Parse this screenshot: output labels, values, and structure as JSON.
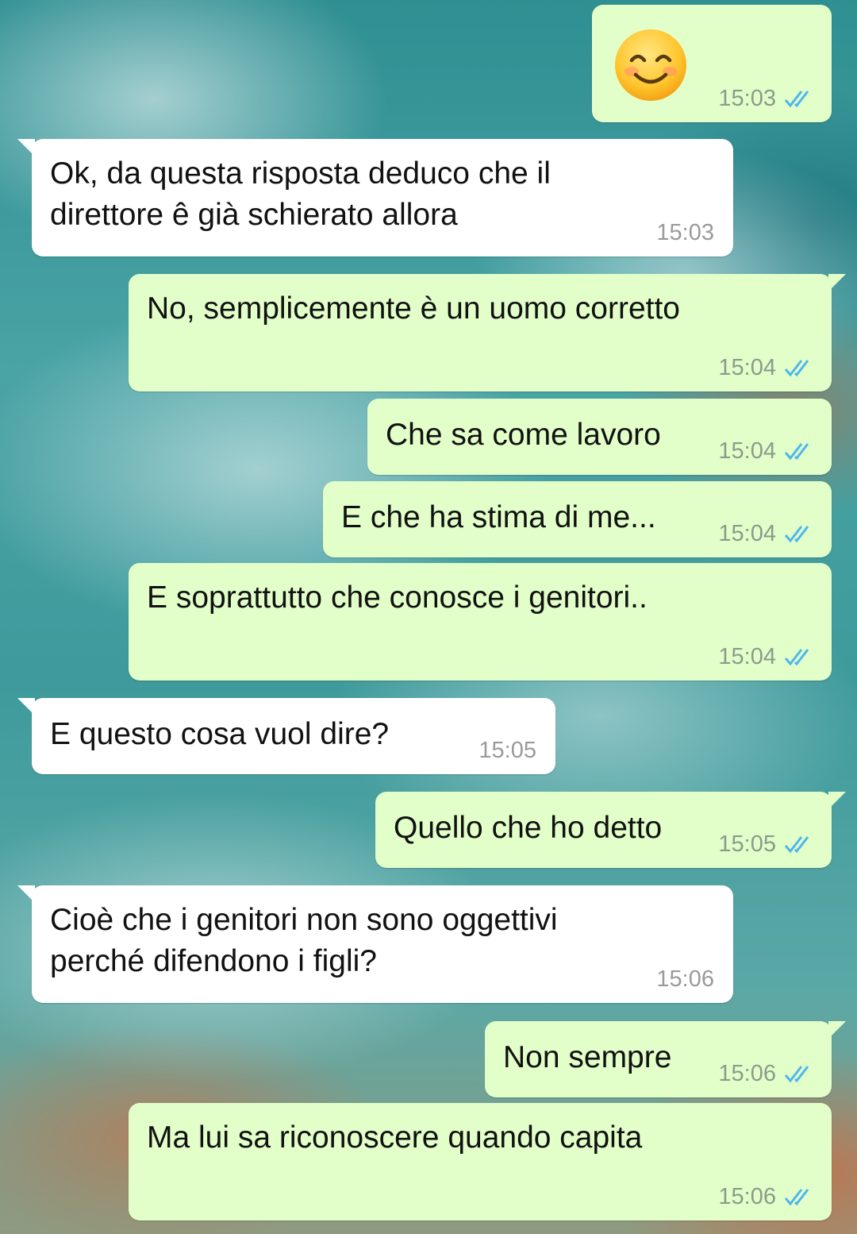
{
  "colors": {
    "outgoing_bubble": "#e2ffc9",
    "incoming_bubble": "#ffffff",
    "read_tick": "#4fb6ec"
  },
  "messages": [
    {
      "direction": "out",
      "type": "emoji",
      "emoji": "smiling-face-with-smiling-eyes",
      "time": "15:03",
      "status": "read"
    },
    {
      "direction": "in",
      "text": "Ok, da questa risposta deduco che il\ndirettore ê già schierato allora",
      "time": "15:03"
    },
    {
      "direction": "out",
      "text": "No, semplicemente è un uomo corretto",
      "time": "15:04",
      "status": "read"
    },
    {
      "direction": "out",
      "text": "Che sa come lavoro",
      "time": "15:04",
      "status": "read"
    },
    {
      "direction": "out",
      "text": "E che ha stima di me...",
      "time": "15:04",
      "status": "read"
    },
    {
      "direction": "out",
      "text": "E soprattutto che conosce i genitori..",
      "time": "15:04",
      "status": "read"
    },
    {
      "direction": "in",
      "text": "E questo cosa vuol dire?",
      "time": "15:05"
    },
    {
      "direction": "out",
      "text": "Quello che ho detto",
      "time": "15:05",
      "status": "read"
    },
    {
      "direction": "in",
      "text": "Cioè che i genitori non sono oggettivi\nperché difendono i figli?",
      "time": "15:06"
    },
    {
      "direction": "out",
      "text": "Non sempre",
      "time": "15:06",
      "status": "read"
    },
    {
      "direction": "out",
      "text": "Ma lui sa riconoscere quando capita",
      "time": "15:06",
      "status": "read"
    }
  ]
}
